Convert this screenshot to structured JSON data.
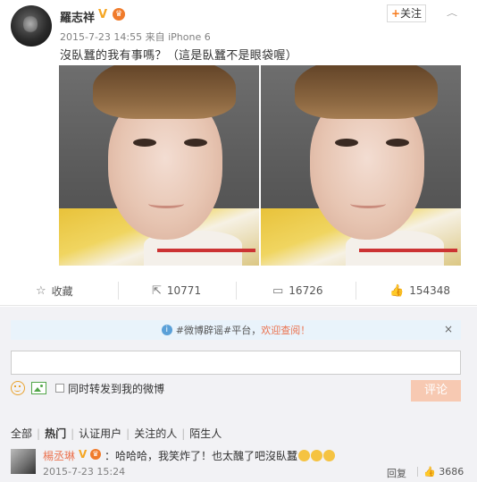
{
  "post": {
    "author": "羅志祥",
    "verified_mark": "V",
    "crown_mark": "♛",
    "follow_label": "关注",
    "follow_plus": "+",
    "menu_chevron": "︿",
    "timestamp": "2015-7-23 14:55",
    "source": "来自 iPhone 6",
    "text": "沒臥蠶的我有事嗎？（這是臥蠶不是眼袋喔）"
  },
  "actions": {
    "favorite_label": "收藏",
    "repost_count": "10771",
    "comment_count": "16726",
    "like_count": "154348"
  },
  "notice": {
    "hashtag": "#微博辟谣#平台，",
    "welcome": "欢迎查阅！",
    "close": "×"
  },
  "comment_form": {
    "input_value": "",
    "repost_label": "同时转发到我的微博",
    "submit_label": "评论"
  },
  "filters": {
    "items": [
      "全部",
      "热门",
      "认证用户",
      "关注的人",
      "陌生人"
    ],
    "active": "热门"
  },
  "comment": {
    "user": "楊丞琳",
    "verified_mark": "V",
    "crown_mark": "♛",
    "text": "：哈哈哈，我笑炸了！也太醜了吧沒臥蠶",
    "time": "2015-7-23 15:24",
    "reply_label": "回复",
    "like_count": "3686"
  },
  "colors": {
    "accent_orange": "#eb7350",
    "notice_bg": "#e9f3fb",
    "submit_bg": "#f7c9b2",
    "verified_yellow": "#f5a623"
  },
  "icons": {
    "favorite": "star-icon",
    "repost": "repost-icon",
    "comment": "comment-icon",
    "like": "thumbs-up-icon",
    "notice": "info-icon",
    "emoji": "emoji-icon",
    "image": "image-icon"
  }
}
